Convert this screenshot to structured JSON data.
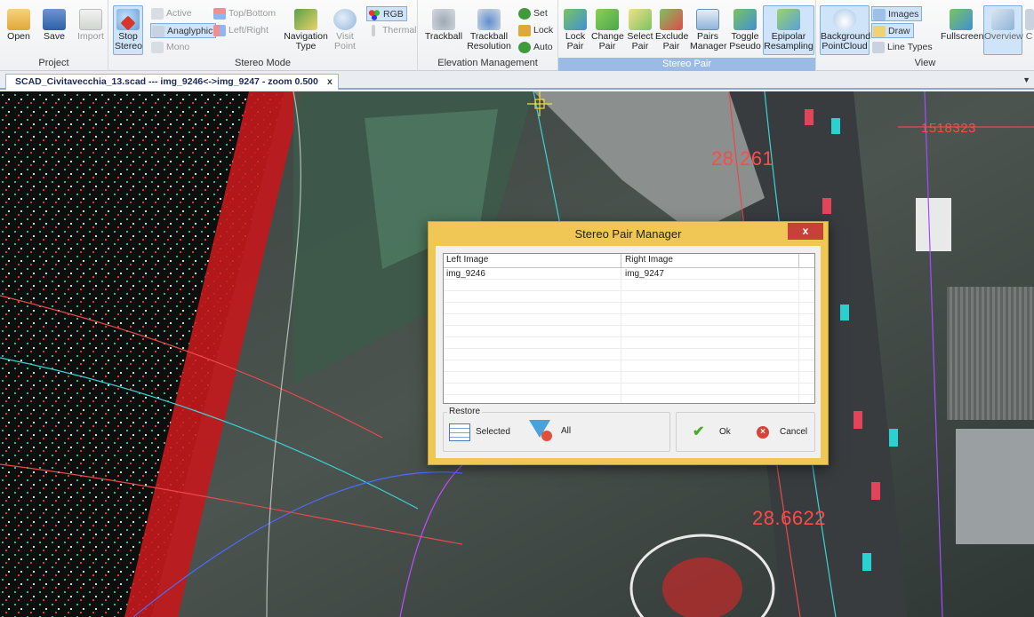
{
  "ribbon": {
    "project": {
      "label": "Project",
      "open": "Open",
      "save": "Save",
      "import": "Import"
    },
    "stereo_mode": {
      "label": "Stereo Mode",
      "stop_stereo": "Stop Stereo",
      "active": "Active",
      "anaglyphic": "Anaglyphic",
      "mono": "Mono",
      "top_bottom": "Top/Bottom",
      "left_right": "Left/Right",
      "navigation_type": "Navigation Type",
      "visit_point": "Visit Point",
      "rgb": "RGB",
      "thermal": "Thermal"
    },
    "elevation_management": {
      "label": "Elevation Management",
      "trackball": "Trackball",
      "trackball_resolution": "Trackball Resolution",
      "set": "Set",
      "lock": "Lock",
      "auto": "Auto"
    },
    "stereo_pair": {
      "label": "Stereo Pair",
      "lock_pair": "Lock Pair",
      "change_pair": "Change Pair",
      "select_pair": "Select Pair",
      "exclude_pair": "Exclude Pair",
      "pairs_manager": "Pairs Manager",
      "toggle_pseudo": "Toggle Pseudo",
      "epipolar_resampling": "Epipolar Resampling"
    },
    "view": {
      "label": "View",
      "background_pointcloud": "Background PointCloud",
      "images": "Images",
      "draw": "Draw",
      "line_types": "Line Types",
      "fullscreen": "Fullscreen",
      "overview": "Overview",
      "partial": "C"
    }
  },
  "document_tab": {
    "title": "SCAD_Civitavecchia_13.scad --- img_9246<->img_9247 - zoom 0.500",
    "close": "x"
  },
  "viewport": {
    "elevations": [
      "28.261",
      "28.6622",
      "1518323"
    ]
  },
  "dialog": {
    "title": "Stereo Pair Manager",
    "close": "x",
    "columns": [
      "Left Image",
      "Right Image"
    ],
    "rows": [
      {
        "left": "img_9246",
        "right": "img_9247"
      }
    ],
    "restore_label": "Restore",
    "selected_label": "Selected",
    "all_label": "All",
    "ok_label": "Ok",
    "cancel_label": "Cancel"
  },
  "colors": {
    "dialog_frame": "#f0c755",
    "close_button": "#c7403a",
    "ribbon_selected": "#cfe4f9",
    "elevation_text": "#ff4a4a"
  }
}
